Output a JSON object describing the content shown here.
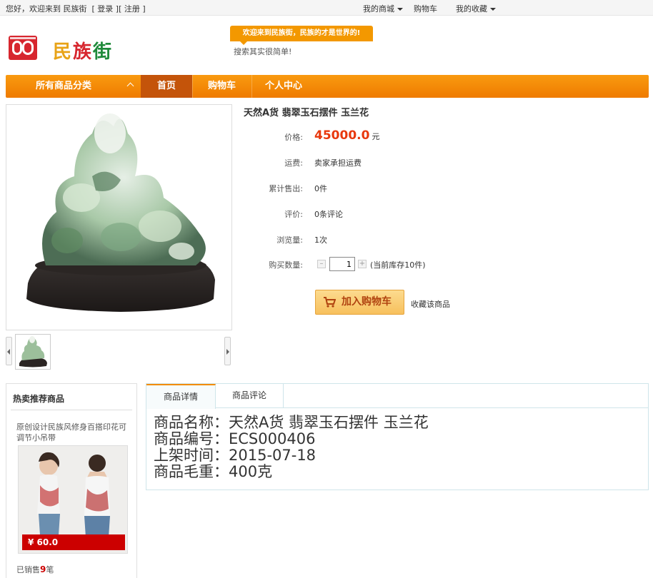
{
  "topbar": {
    "greeting": "您好，欢迎来到 民族街",
    "login": "登录",
    "register": "注册",
    "my_mall": "我的商城",
    "cart": "购物车",
    "favorites": "我的收藏"
  },
  "header": {
    "logo_text_1": "民",
    "logo_text_2": "族",
    "logo_text_3": "街",
    "slogan": "欢迎来到民族街，民族的才是世界的!",
    "search_hint": "搜索其实很简单!"
  },
  "nav": {
    "categories": "所有商品分类",
    "items": [
      "首页",
      "购物车",
      "个人中心"
    ]
  },
  "product": {
    "title": "天然A货 翡翠玉石摆件 玉兰花",
    "price_label": "价格:",
    "price": "45000.0",
    "price_unit": "元",
    "shipping_label": "运费:",
    "shipping": "卖家承担运费",
    "sold_label": "累计售出:",
    "sold": "0件",
    "reviews_label": "评价:",
    "reviews": "0条评论",
    "views_label": "浏览量:",
    "views": "1次",
    "qty_label": "购买数量:",
    "qty": "1",
    "stock": "(当前库存10件)",
    "add_to_cart": "加入购物车",
    "favorite": "收藏该商品"
  },
  "sidebar": {
    "title": "热卖推荐商品",
    "item_name": "原创设计民族风修身百搭印花可调节小吊带",
    "item_price": "¥ 60.0",
    "sold_prefix": "已销售",
    "sold_count": "9",
    "sold_suffix": "笔"
  },
  "details": {
    "tabs": [
      "商品详情",
      "商品评论"
    ],
    "lines": [
      "商品名称：天然A货 翡翠玉石摆件 玉兰花",
      "商品编号：ECS000406",
      "上架时间：2015-07-18",
      "商品毛重：400克"
    ]
  },
  "colors": {
    "accent": "#f39800",
    "nav_active": "#c4540a",
    "price": "#e8380d",
    "sidebar_price_bg": "#cc0000"
  }
}
